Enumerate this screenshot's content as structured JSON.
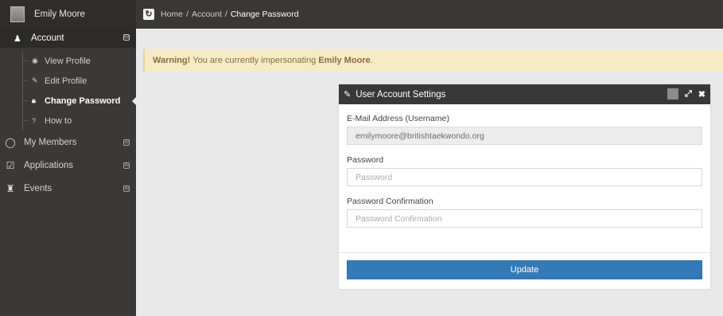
{
  "user": {
    "name": "Emily Moore"
  },
  "breadcrumb": {
    "home": "Home",
    "sep": "/",
    "account": "Account",
    "current": "Change Password"
  },
  "sidebar": {
    "section": {
      "label": "Account",
      "toggle": "⊟"
    },
    "sub_items": [
      {
        "label": "View Profile",
        "icon": "eye-icon",
        "glyph": "◉"
      },
      {
        "label": "Edit Profile",
        "icon": "edit-icon",
        "glyph": "✎"
      },
      {
        "label": "Change Password",
        "icon": "lock-icon",
        "glyph": "🔒︎"
      },
      {
        "label": "How to",
        "icon": "question-icon",
        "glyph": "?"
      }
    ],
    "main_items": [
      {
        "label": "My Members",
        "icon": "user-circle-icon",
        "glyph": "◯",
        "toggle": "⊞"
      },
      {
        "label": "Applications",
        "icon": "check-square-icon",
        "glyph": "☑",
        "toggle": "⊞"
      },
      {
        "label": "Events",
        "icon": "trophy-icon",
        "glyph": "♜",
        "toggle": "⊞"
      }
    ]
  },
  "warning": {
    "strong": "Warning!",
    "text": "You are currently impersonating",
    "name": "Emily Moore",
    "end": "."
  },
  "panel": {
    "title": "User Account Settings",
    "email_label": "E-Mail Address (Username)",
    "email_value": "emilymoore@britishtaekwondo.org",
    "password_label": "Password",
    "password_placeholder": "Password",
    "confirm_label": "Password Confirmation",
    "confirm_placeholder": "Password Confirmation",
    "update_label": "Update"
  },
  "colors": {
    "dark": "#3a3836",
    "sidebar": "#3b3937",
    "primary": "#337ab7",
    "warning_bg": "#f7ebc6",
    "warning_text": "#8a6d3b"
  }
}
